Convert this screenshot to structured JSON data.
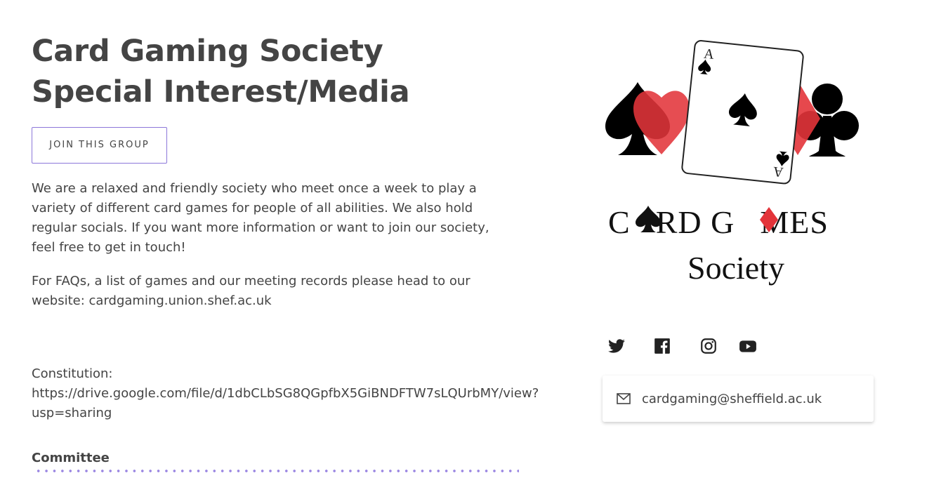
{
  "header": {
    "title_line1": "Card Gaming Society",
    "title_line2": "Special Interest/Media"
  },
  "join_button_label": "JOIN THIS GROUP",
  "description": "We are a relaxed and friendly society who meet once a week to play a variety of different card games for people of all abilities. We also hold regular socials. If you want more information or want to join our society, feel free to get in touch!",
  "faq_text": "For FAQs, a list of games and our meeting records please head to our website: cardgaming.union.shef.ac.uk",
  "constitution": {
    "label": "Constitution:",
    "url": "https://drive.google.com/file/d/1dbCLbSG8QGpfbX5GiBNDFTW7sLQUrbMY/view?usp=sharing"
  },
  "committee_heading": "Committee",
  "logo": {
    "card_rank": "A",
    "text_line1_a": "C",
    "text_line1_b": "RD G",
    "text_line1_c": "MES",
    "text_line2": "Society"
  },
  "social_icons": [
    "twitter-icon",
    "facebook-icon",
    "instagram-icon",
    "youtube-icon"
  ],
  "contact": {
    "email": "cardgaming@sheffield.ac.uk",
    "icon": "mail-icon"
  },
  "colors": {
    "accent": "#8c77d9",
    "heart_red": "#e3343a",
    "text": "#444444"
  }
}
